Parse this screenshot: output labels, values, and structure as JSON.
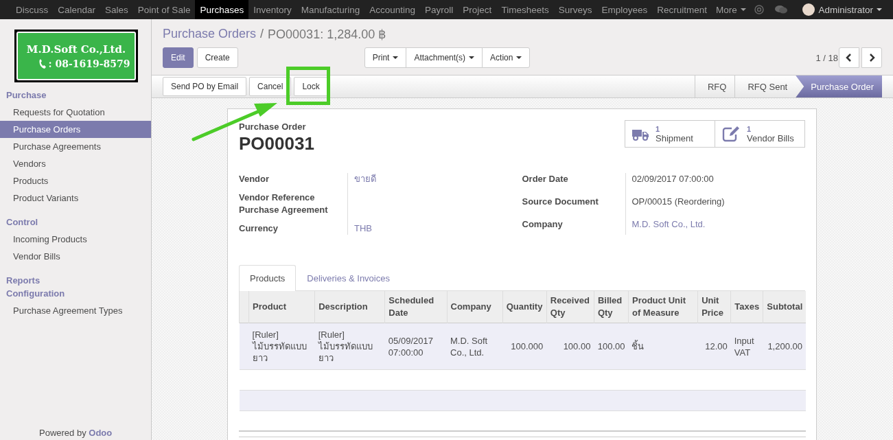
{
  "nav": {
    "apps": [
      {
        "label": "Discuss",
        "selected": false
      },
      {
        "label": "Calendar",
        "selected": false
      },
      {
        "label": "Sales",
        "selected": false
      },
      {
        "label": "Point of Sale",
        "selected": false
      },
      {
        "label": "Purchases",
        "selected": true
      },
      {
        "label": "Inventory",
        "selected": false
      },
      {
        "label": "Manufacturing",
        "selected": false
      },
      {
        "label": "Accounting",
        "selected": false
      },
      {
        "label": "Payroll",
        "selected": false
      },
      {
        "label": "Project",
        "selected": false
      },
      {
        "label": "Timesheets",
        "selected": false
      },
      {
        "label": "Surveys",
        "selected": false
      },
      {
        "label": "Employees",
        "selected": false
      },
      {
        "label": "Recruitment",
        "selected": false
      }
    ],
    "more": "More",
    "user": "Administrator"
  },
  "sidebar": {
    "logo": {
      "name": "M.D.Soft Co.,Ltd.",
      "phone": ": 08-1619-8579"
    },
    "sections": [
      {
        "title": "Purchase",
        "items": [
          {
            "label": "Requests for Quotation",
            "selected": false
          },
          {
            "label": "Purchase Orders",
            "selected": true
          },
          {
            "label": "Purchase Agreements",
            "selected": false
          },
          {
            "label": "Vendors",
            "selected": false
          },
          {
            "label": "Products",
            "selected": false
          },
          {
            "label": "Product Variants",
            "selected": false
          }
        ]
      },
      {
        "title": "Control",
        "items": [
          {
            "label": "Incoming Products",
            "selected": false
          },
          {
            "label": "Vendor Bills",
            "selected": false
          }
        ]
      },
      {
        "title": "Reports"
      },
      {
        "title": "Configuration",
        "items": [
          {
            "label": "Purchase Agreement Types",
            "selected": false
          }
        ]
      }
    ],
    "footer": {
      "text": "Powered by",
      "brand": "Odoo"
    }
  },
  "breadcrumb": {
    "parent": "Purchase Orders",
    "separator": "/",
    "current": "PO00031: 1,284.00 ฿"
  },
  "buttons": [
    {
      "label": "Edit",
      "kind": "primary"
    },
    {
      "label": "Create",
      "kind": "default"
    }
  ],
  "dropdowns": [
    "Print",
    "Attachment(s)",
    "Action"
  ],
  "pager": "1 / 18",
  "status_actions": [
    "Send PO by Email",
    "Cancel",
    "Lock"
  ],
  "stages": [
    {
      "label": "RFQ",
      "selected": false
    },
    {
      "label": "RFQ Sent",
      "selected": false
    },
    {
      "label": "Purchase Order",
      "selected": true
    }
  ],
  "sheet": {
    "doc_type": "Purchase Order",
    "name": "PO00031",
    "smart_buttons": [
      {
        "kind": "truck",
        "count": "1",
        "label": "Shipment"
      },
      {
        "kind": "edit",
        "count": "1",
        "label": "Vendor Bills"
      }
    ],
    "left_fields": [
      {
        "label": "Vendor",
        "value": "ขายดี",
        "kind": "link"
      },
      {
        "label": "Vendor Reference"
      },
      {
        "label": "Purchase Agreement"
      },
      {
        "label": "Currency",
        "value": "THB",
        "kind": "link"
      }
    ],
    "right_fields": [
      {
        "label": "Order Date",
        "value": "02/09/2017 07:00:00",
        "kind": "text"
      },
      {
        "label": "Source Document",
        "value": "OP/00015 (Reordering)",
        "kind": "text"
      },
      {
        "label": "Company",
        "value": "M.D. Soft Co., Ltd.",
        "kind": "link"
      }
    ],
    "tabs": [
      {
        "label": "Products",
        "selected": true
      },
      {
        "label": "Deliveries & Invoices",
        "selected": false
      }
    ],
    "table": {
      "columns": [
        "Product",
        "Description",
        "Scheduled Date",
        "Company",
        "Quantity",
        "Received Qty",
        "Billed Qty",
        "Product Unit of Measure",
        "Unit Price",
        "Taxes",
        "Subtotal"
      ],
      "rows": [
        [
          "[Ruler] ไม้บรรทัดแบบยาว",
          "[Ruler] ไม้บรรทัดแบบยาว",
          "05/09/2017 07:00:00",
          "M.D. Soft Co., Ltd.",
          "100.000",
          "100.00",
          "100.00",
          "ชิ้น",
          "12.00",
          "Input VAT",
          "1,200.00"
        ]
      ]
    }
  }
}
